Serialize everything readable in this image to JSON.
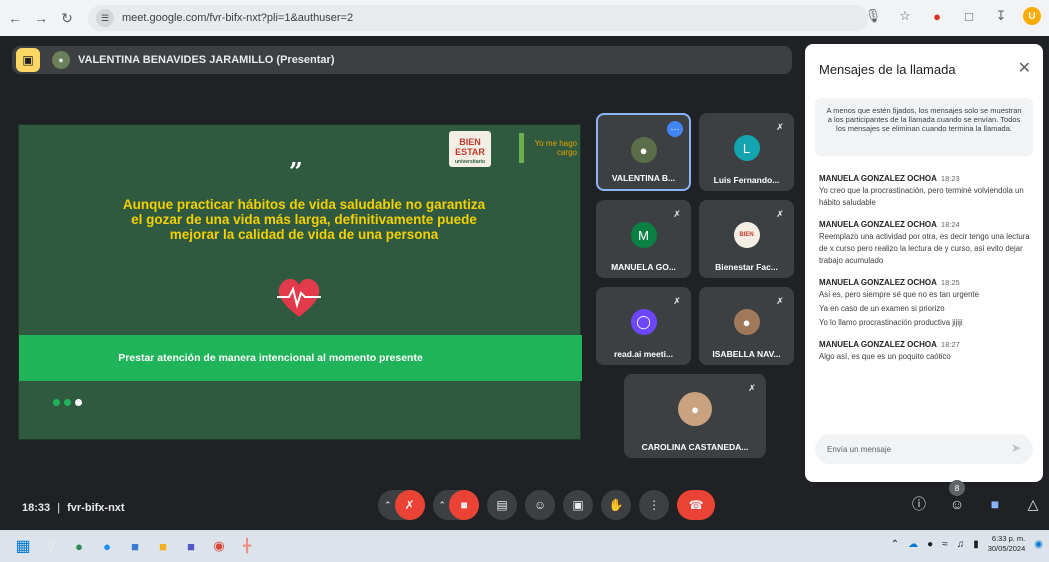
{
  "browser": {
    "url": "meet.google.com/fvr-bifx-nxt?pli=1&authuser=2",
    "profile_initial": "U"
  },
  "presenter": {
    "name": "VALENTINA BENAVIDES JARAMILLO (Presentar)"
  },
  "slide": {
    "logo_bien": "BIEN ESTAR",
    "logo_bien_sub": "universitario",
    "logo_yome": "Yo me hago cargo",
    "quote_mark": "”",
    "quote": "Aunque practicar hábitos de vida saludable no garantiza el gozar de una vida más larga, definitivamente puede mejorar la calidad de vida de una persona",
    "band_text": "Prestar atención de manera intencional al momento presente",
    "dots_total": 3,
    "dots_active_index": 2
  },
  "participants": [
    {
      "name": "VALENTINA B...",
      "avatar": "",
      "avatar_color": "#5b6e47",
      "muted": false,
      "highlight": true
    },
    {
      "name": "Luis Fernando...",
      "avatar": "L",
      "avatar_color": "#12a4af",
      "muted": true,
      "highlight": false
    },
    {
      "name": "MANUELA GO...",
      "avatar": "M",
      "avatar_color": "#0b8043",
      "muted": true,
      "highlight": false
    },
    {
      "name": "Bienestar Fac...",
      "avatar": "",
      "avatar_color": "#f3efe4",
      "muted": true,
      "highlight": false
    },
    {
      "name": "read.ai meeti...",
      "avatar": "",
      "avatar_color": "#6c47ff",
      "muted": true,
      "highlight": false
    },
    {
      "name": "ISABELLA NAV...",
      "avatar": "",
      "avatar_color": "#a0785a",
      "muted": true,
      "highlight": false
    },
    {
      "name": "CAROLINA CASTANEDA...",
      "avatar": "",
      "avatar_color": "#c9a37f",
      "muted": true,
      "highlight": false
    }
  ],
  "chat": {
    "title": "Mensajes de la llamada",
    "notice": "A menos que estén fijados, los mensajes solo se muestran a los participantes de la llamada cuando se envían. Todos los mensajes se eliminan cuando termina la llamada.",
    "messages": [
      {
        "sender": "MANUELA GONZALEZ OCHOA",
        "time": "18:23",
        "lines": [
          "Yo creo que la procrastinación, pero terminé volviendola un hábito saludable"
        ]
      },
      {
        "sender": "MANUELA GONZALEZ OCHOA",
        "time": "18:24",
        "lines": [
          "Reemplazo una actividad por otra, es decir tengo una lectura de x curso pero realizo la lectura de y curso, así evito dejar trabajo acumulado"
        ]
      },
      {
        "sender": "MANUELA GONZALEZ OCHOA",
        "time": "18:25",
        "lines": [
          "Así es, pero siempre sé que no es tan urgente",
          "Ya en caso de un examen si priorizo",
          "Yo lo llamo procrastinación productiva jijiji"
        ]
      },
      {
        "sender": "MANUELA GONZALEZ OCHOA",
        "time": "18:27",
        "lines": [
          "Algo así, es que es un poquito caótico"
        ]
      }
    ],
    "input_placeholder": "Envía un mensaje"
  },
  "bottom": {
    "clock": "18:33",
    "separator": "|",
    "meeting_code": "fvr-bifx-nxt",
    "people_count": "8"
  },
  "taskbar": {
    "time": "6:33 p. m.",
    "date": "30/05/2024"
  },
  "colors": {
    "meet_bg": "#202124",
    "slide_green": "#2f5a3f",
    "band_green": "#1fb45a",
    "quote_yellow": "#f4d000",
    "end_call_red": "#ea4335",
    "accent_blue": "#8ab4f8"
  }
}
